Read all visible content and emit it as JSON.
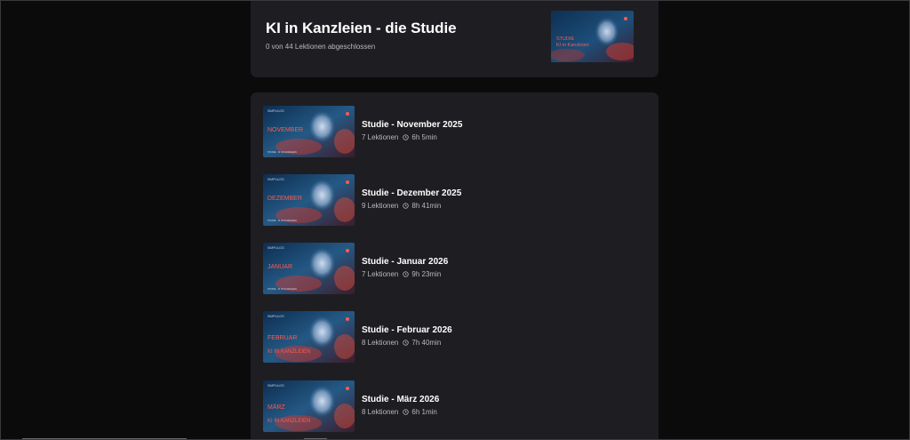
{
  "course": {
    "title": "KI in Kanzleien - die Studie",
    "progress": "0 von 44 Lektionen abgeschlossen",
    "thumbnail": {
      "line1": "STUDIE",
      "line2": "KI in Kanzleien"
    }
  },
  "modules": [
    {
      "title": "Studie - November 2025",
      "lessons": "7 Lektionen",
      "duration": "6h 5min",
      "thumb_label": "NOVEMBER",
      "thumb_label2": ""
    },
    {
      "title": "Studie - Dezember 2025",
      "lessons": "9 Lektionen",
      "duration": "8h 41min",
      "thumb_label": "DEZEMBER",
      "thumb_label2": ""
    },
    {
      "title": "Studie - Januar 2026",
      "lessons": "7 Lektionen",
      "duration": "9h 23min",
      "thumb_label": "JANUAR",
      "thumb_label2": ""
    },
    {
      "title": "Studie - Februar 2026",
      "lessons": "8 Lektionen",
      "duration": "7h 40min",
      "thumb_label": "FEBRUAR",
      "thumb_label2": "KI IN KANZLEIEN"
    },
    {
      "title": "Studie - März 2026",
      "lessons": "8 Lektionen",
      "duration": "6h 1min",
      "thumb_label": "MÄRZ",
      "thumb_label2": "KI IN KANZLEIEN"
    }
  ],
  "icons": {
    "duration": "clock-icon"
  },
  "colors": {
    "background": "#0b0b0c",
    "card": "#1e1e22",
    "accent": "#ff5a4e",
    "muted_text": "#b7b7bd"
  }
}
